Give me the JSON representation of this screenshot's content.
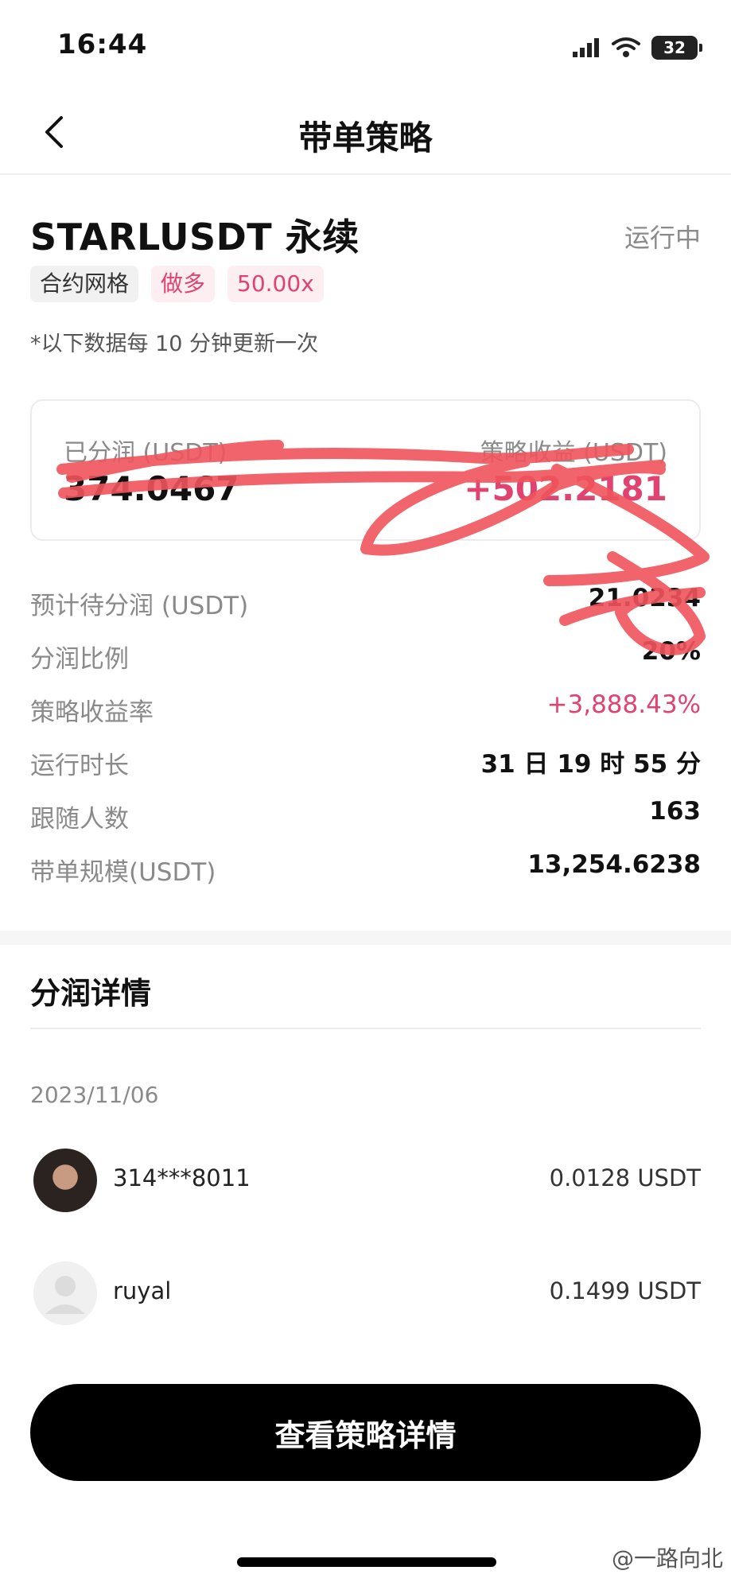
{
  "status_bar": {
    "time": "16:44",
    "battery": "32"
  },
  "nav": {
    "title": "带单策略"
  },
  "strategy": {
    "title": "STARLUSDT 永续",
    "status": "运行中",
    "tags": [
      "合约网格",
      "做多",
      "50.00x"
    ],
    "update_note": "*以下数据每 10 分钟更新一次"
  },
  "profit_card": {
    "left_label": "已分润 (USDT)",
    "left_value": "374.0467",
    "right_label": "策略收益 (USDT)",
    "right_value": "+502.2181"
  },
  "stats": [
    {
      "label": "预计待分润 (USDT)",
      "value": "21.0234"
    },
    {
      "label": "分润比例",
      "value": "20%"
    },
    {
      "label": "策略收益率",
      "value": "+3,888.43%"
    },
    {
      "label": "运行时长",
      "value": "31 日 19 时 55 分"
    },
    {
      "label": "跟随人数",
      "value": "163"
    },
    {
      "label": "带单规模(USDT)",
      "value": "13,254.6238"
    }
  ],
  "share_details": {
    "title": "分润详情",
    "date": "2023/11/06",
    "items": [
      {
        "name": "314***8011",
        "amount": "0.0128 USDT"
      },
      {
        "name": "ruyal",
        "amount": "0.1499 USDT"
      }
    ]
  },
  "cta": {
    "label": "查看策略详情"
  },
  "watermark": "@一路向北",
  "colors": {
    "accent": "#e0436f",
    "scribble": "#f0545c",
    "button": "#000000"
  }
}
